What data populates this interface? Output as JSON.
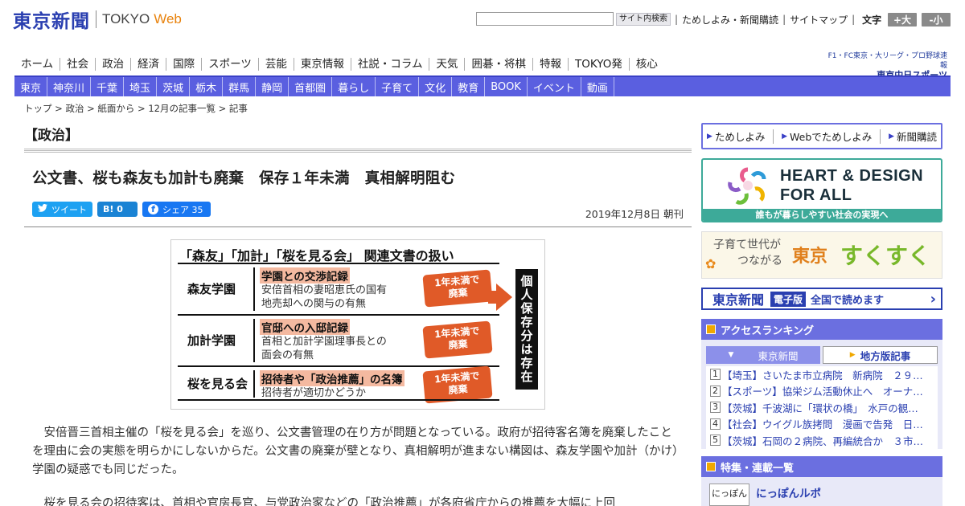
{
  "header": {
    "logo_jp": "東京新聞",
    "logo_en": "TOKYO",
    "logo_web": "Web",
    "search_button": "サイト内検索",
    "search_value": "",
    "link_tameshi": "ためしよみ・新聞購読",
    "link_sitemap": "サイトマップ",
    "font_size_label": "文字（0）",
    "font_up": "+大",
    "font_down": "-小"
  },
  "main_nav": [
    "ホーム",
    "社会",
    "政治",
    "経済",
    "国際",
    "スポーツ",
    "芸能",
    "東京情報",
    "社説・コラム",
    "天気",
    "囲碁・将棋",
    "特報",
    "TOKYO発",
    "核心"
  ],
  "chunichi": {
    "line1": "F1・FC東京・大リーグ・プロ野球速報",
    "line2": "東京中日スポーツ"
  },
  "sub_nav": [
    "東京",
    "神奈川",
    "千葉",
    "埼玉",
    "茨城",
    "栃木",
    "群馬",
    "静岡",
    "首都圏",
    "暮らし",
    "子育て",
    "文化",
    "教育",
    "BOOK",
    "イベント",
    "動画"
  ],
  "breadcrumb": "トップ > 政治 > 紙面から > 12月の記事一覧 > 記事",
  "section_title": "【政治】",
  "article": {
    "headline": "公文書、桜も森友も加計も廃棄　保存１年未満　真相解明阻む",
    "tweet_label": "ツイート",
    "hatena_label": "B! 0",
    "fb_label": "シェア 35",
    "date": "2019年12月8日 朝刊",
    "paragraph1": "安倍晋三首相主催の「桜を見る会」を巡り、公文書管理の在り方が問題となっている。政府が招待客名簿を廃棄したことを理由に会の実態を明らかにしないからだ。公文書の廃棄が壁となり、真相解明が進まない構図は、森友学園や加計（かけ）学園の疑惑でも同じだった。",
    "paragraph2": "桜を見る会の招待客は、首相や官房長官、与党政治家などの「政治推薦」が各府省庁からの推薦を大幅に上回"
  },
  "figure": {
    "title": "「森友」「加計」「桜を見る会」 関連文書の扱い",
    "rows": [
      {
        "name": "森友学園",
        "doc": "学園との交渉記録",
        "desc1": "安倍首相の妻昭恵氏の国有",
        "desc2": "地売却への関与の有無",
        "stamp1": "1年未満で",
        "stamp2": "廃棄"
      },
      {
        "name": "加計学園",
        "doc": "官邸への入邸記録",
        "desc1": "首相と加計学園理事長との",
        "desc2": "面会の有無",
        "stamp1": "1年未満で",
        "stamp2": "廃棄"
      },
      {
        "name": "桜を見る会",
        "doc": "招待者や「政治推薦」の名簿",
        "desc1": "招待者が適切かどうか",
        "desc2": "",
        "stamp1": "1年未満で",
        "stamp2": "廃棄"
      }
    ],
    "box_text": "個人保存分は存在"
  },
  "sidebar": {
    "links": [
      "ためしよみ",
      "Webでためしよみ",
      "新聞購読"
    ],
    "heart_line1": "HEART & DESIGN",
    "heart_line2": "FOR ALL",
    "heart_footer": "誰もが暮らしやすい社会の実現へ",
    "suku_line1": "子育て世代が",
    "suku_line2": "つながる",
    "suku_tokyo": "東京",
    "suku_name": "すくすく",
    "ed_logo": "東京新聞",
    "ed_badge": "電子版",
    "ed_read": "全国で読めます",
    "ranking_title": "アクセスランキング",
    "ranking_tab1": "東京新聞",
    "ranking_tab2": "地方版記事",
    "ranking": [
      {
        "n": "1",
        "text": "【埼玉】さいたま市立病院　新病院　２９…"
      },
      {
        "n": "2",
        "text": "【スポーツ】協栄ジム活動休止へ　オーナ…"
      },
      {
        "n": "3",
        "text": "【茨城】千波湖に「環状の橋」　水戸の観…"
      },
      {
        "n": "4",
        "text": "【社会】ウイグル族拷問　漫画で告発　日…"
      },
      {
        "n": "5",
        "text": "【茨城】石岡の２病院、再編統合か　３市…"
      }
    ],
    "feature_title": "特集・連載一覧",
    "feature_thumb": "にっぽん",
    "feature_item": "にっぽんルポ"
  },
  "colors": {
    "brand_blue": "#2a3fb0",
    "nav_purple": "#5a5fe0",
    "accent_orange": "#e05a28"
  }
}
